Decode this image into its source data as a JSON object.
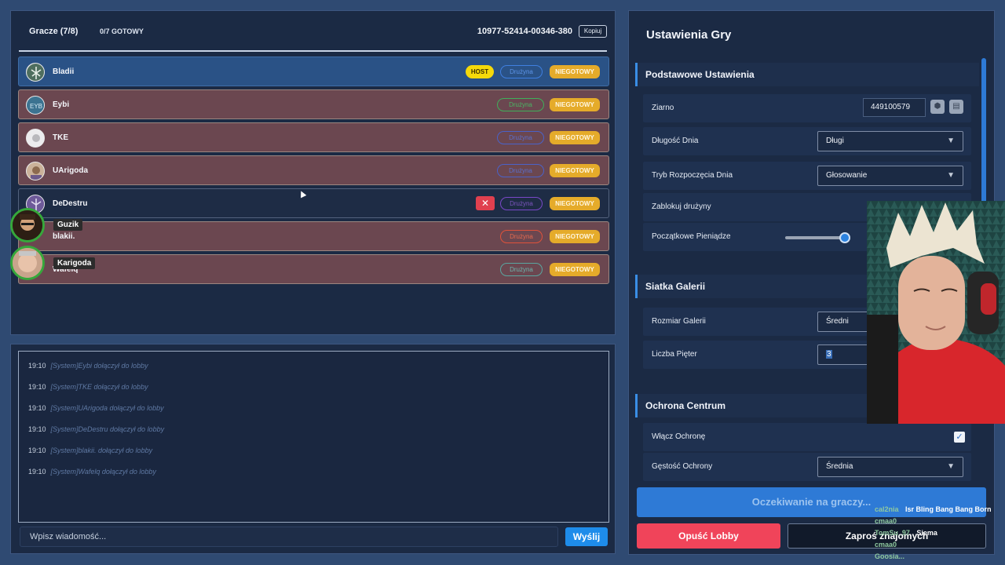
{
  "players": {
    "title": "Gracze (7/8)",
    "ready_count": "0/7 GOTOWY",
    "lobby_code": "10977-52414-00346-380",
    "copy_label": "Kopiuj",
    "host_badge": "HOST",
    "rows": [
      {
        "name": "Bladii",
        "team": "Drużyna",
        "team_color": "#3f7fe0",
        "status": "NIEGOTOWY"
      },
      {
        "name": "Eybi",
        "team": "Drużyna",
        "team_color": "#3fb05a",
        "status": "NIEGOTOWY"
      },
      {
        "name": "TKE",
        "team": "Drużyna",
        "team_color": "#4a62c8",
        "status": "NIEGOTOWY"
      },
      {
        "name": "UArigoda",
        "team": "Drużyna",
        "team_color": "#4a62c8",
        "status": "NIEGOTOWY"
      },
      {
        "name": "DeDestru",
        "team": "Drużyna",
        "team_color": "#7a48c8",
        "status": "NIEGOTOWY"
      },
      {
        "name": "blakii.",
        "team": "Drużyna",
        "team_color": "#e0523a",
        "status": "NIEGOTOWY"
      },
      {
        "name": "Wafelq",
        "team": "Drużyna",
        "team_color": "#5aa6a0",
        "status": "NIEGOTOWY"
      }
    ],
    "overlay_names": [
      "Guzik",
      "Karigoda"
    ]
  },
  "chat": {
    "messages": [
      {
        "time": "19:10",
        "text": "[System]Eybi dołączył do lobby"
      },
      {
        "time": "19:10",
        "text": "[System]TKE dołączył do lobby"
      },
      {
        "time": "19:10",
        "text": "[System]UArigoda dołączył do lobby"
      },
      {
        "time": "19:10",
        "text": "[System]DeDestru dołączył do lobby"
      },
      {
        "time": "19:10",
        "text": "[System]blakii. dołączył do lobby"
      },
      {
        "time": "19:10",
        "text": "[System]Wafelq dołączył do lobby"
      }
    ],
    "input_placeholder": "Wpisz wiadomość...",
    "send_label": "Wyślij"
  },
  "settings": {
    "title": "Ustawienia Gry",
    "sections": {
      "basic": "Podstawowe Ustawienia",
      "gallery": "Siatka Galerii",
      "protection": "Ochrona Centrum"
    },
    "seed_label": "Ziarno",
    "seed_value": "449100579",
    "day_length_label": "Długość Dnia",
    "day_length_value": "Długi",
    "day_start_label": "Tryb Rozpoczęcia Dnia",
    "day_start_value": "Głosowanie",
    "lock_teams_label": "Zablokuj drużyny",
    "money_label": "Początkowe Pieniądze",
    "gallery_size_label": "Rozmiar Galerii",
    "gallery_size_value": "Średni",
    "floors_label": "Liczba Pięter",
    "floors_value": "3",
    "protection_toggle_label": "Włącz Ochronę",
    "protection_enabled": true,
    "protection_density_label": "Gęstość Ochrony",
    "protection_density_value": "Średnia",
    "waiting_label": "Oczekiwanie na graczy...",
    "leave_label": "Opuść Lobby",
    "invite_label": "Zaproś znajomych"
  },
  "stream_chat": [
    {
      "user": "cal2nia",
      "msg": "Isr Bling Bang Bang Born"
    },
    {
      "user": "cmaa0",
      "msg": ""
    },
    {
      "user": "TomSu_97",
      "msg": "Siema"
    },
    {
      "user": "cmaa0",
      "msg": ""
    },
    {
      "user": "Goosia...",
      "msg": ""
    }
  ]
}
